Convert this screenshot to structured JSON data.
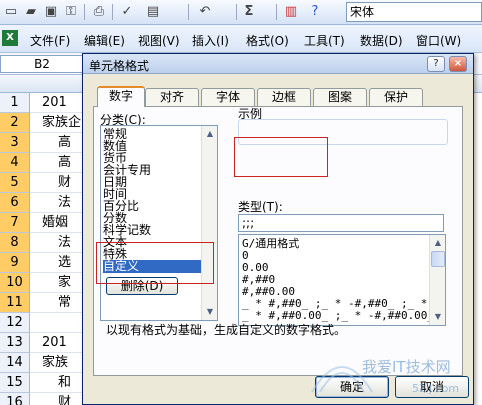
{
  "toolbar": {
    "buttons": [
      "new-icon",
      "open-icon",
      "save-icon",
      "permission-icon",
      "print-icon",
      "spellcheck-icon",
      "paste-icon",
      "undo-icon",
      "sum-icon",
      "chart-icon",
      "help-icon"
    ],
    "sum_glyph": "Σ",
    "font_name": "宋体"
  },
  "menu": {
    "items": [
      "文件(F)",
      "编辑(E)",
      "视图(V)",
      "插入(I)",
      "格式(O)",
      "工具(T)",
      "数据(D)",
      "窗口(W)"
    ]
  },
  "name_box": {
    "value": "B2"
  },
  "sheet": {
    "rows": [
      {
        "num": "1",
        "text": "201",
        "selected": false,
        "left": true
      },
      {
        "num": "2",
        "text": "家族企",
        "selected": true,
        "left": true
      },
      {
        "num": "3",
        "text": "高",
        "selected": true,
        "left": false
      },
      {
        "num": "4",
        "text": "高",
        "selected": true,
        "left": false
      },
      {
        "num": "5",
        "text": "财",
        "selected": true,
        "left": false
      },
      {
        "num": "6",
        "text": "法",
        "selected": true,
        "left": false
      },
      {
        "num": "7",
        "text": "婚姻",
        "selected": true,
        "left": true
      },
      {
        "num": "8",
        "text": "法",
        "selected": true,
        "left": false
      },
      {
        "num": "9",
        "text": "选",
        "selected": true,
        "left": false
      },
      {
        "num": "10",
        "text": "家",
        "selected": true,
        "left": false
      },
      {
        "num": "11",
        "text": "常",
        "selected": true,
        "left": false
      },
      {
        "num": "12",
        "text": "",
        "selected": false,
        "left": false
      },
      {
        "num": "13",
        "text": "201",
        "selected": false,
        "left": true
      },
      {
        "num": "14",
        "text": "家族",
        "selected": false,
        "left": true
      },
      {
        "num": "15",
        "text": "和",
        "selected": false,
        "left": false
      },
      {
        "num": "16",
        "text": "财",
        "selected": false,
        "left": false
      }
    ]
  },
  "dialog": {
    "title": "单元格格式",
    "help_glyph": "?",
    "close_glyph": "×",
    "tabs": [
      "数字",
      "对齐",
      "字体",
      "边框",
      "图案",
      "保护"
    ],
    "active_tab": "数字",
    "category_label": "分类(C):",
    "categories": [
      "常规",
      "数值",
      "货币",
      "会计专用",
      "日期",
      "时间",
      "百分比",
      "分数",
      "科学记数",
      "文本",
      "特殊",
      "自定义"
    ],
    "selected_category": "自定义",
    "example_label": "示例",
    "example_value": "",
    "type_label": "类型(T):",
    "type_value": ";;;",
    "format_list": [
      "G/通用格式",
      "0",
      "0.00",
      "#,##0",
      "#,##0.00",
      "_ * #,##0_ ;_ * -#,##0_ ;_ * \"",
      "_ * #,##0.00_ ;_ * -#,##0.00_"
    ],
    "delete_button": "删除(D)",
    "description": "以现有格式为基础，生成自定义的数字格式。",
    "ok_button": "确定",
    "cancel_button": "取消"
  },
  "watermark": {
    "text": "我爱IT技术网",
    "subtext": "52ij.com"
  }
}
